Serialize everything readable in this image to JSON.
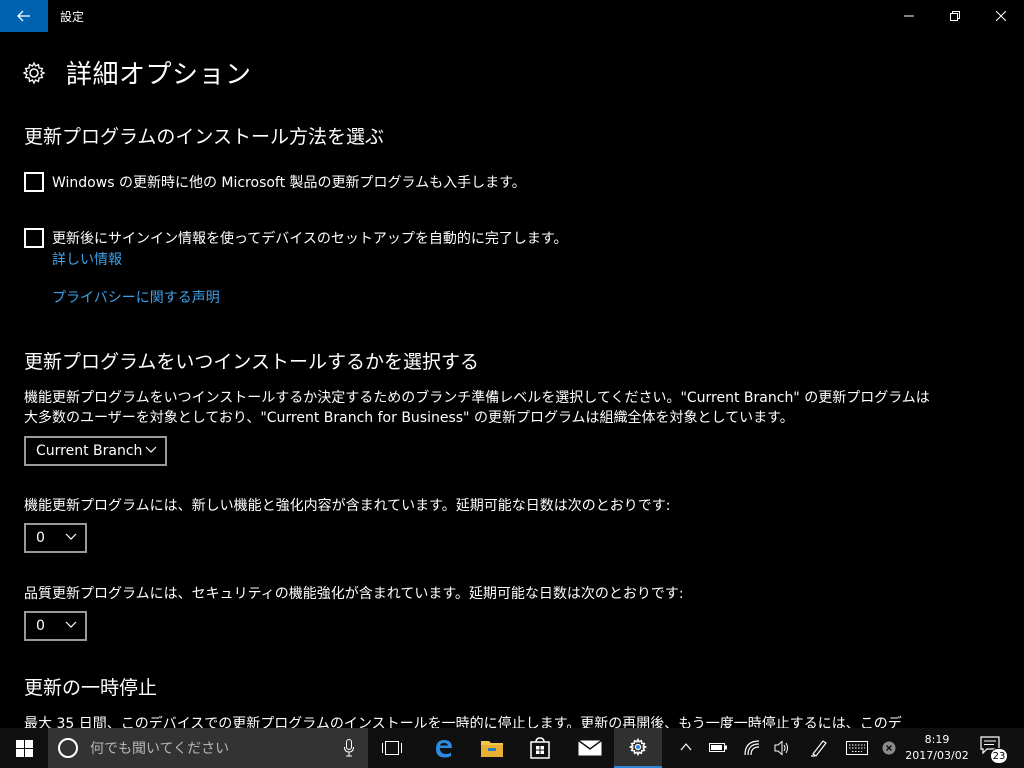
{
  "window": {
    "title": "設定"
  },
  "page": {
    "title": "詳細オプション"
  },
  "section1": {
    "title": "更新プログラムのインストール方法を選ぶ",
    "checkbox1_label": "Windows の更新時に他の Microsoft 製品の更新プログラムも入手します。",
    "checkbox1_checked": false,
    "checkbox2_label": "更新後にサインイン情報を使ってデバイスのセットアップを自動的に完了します。",
    "checkbox2_checked": false,
    "learn_more_link": "詳しい情報",
    "privacy_link": "プライバシーに関する声明"
  },
  "section2": {
    "title": "更新プログラムをいつインストールするかを選択する",
    "description_line1": "機能更新プログラムをいつインストールするか決定するためのブランチ準備レベルを選択してください。\"Current Branch\" の更新プログラムは",
    "description_line2": "大多数のユーザーを対象としており、\"Current Branch for Business\" の更新プログラムは組織全体を対象としています。",
    "branch_dropdown": "Current Branch",
    "feature_text": "機能更新プログラムには、新しい機能と強化内容が含まれています。延期可能な日数は次のとおりです:",
    "feature_days": "0",
    "quality_text": "品質更新プログラムには、セキュリティの機能強化が含まれています。延期可能な日数は次のとおりです:",
    "quality_days": "0"
  },
  "section3": {
    "title": "更新の一時停止",
    "description_partial": "最大 35 日間、このデバイスでの更新プログラムのインストールを一時的に停止します。更新の再開後、もう一度一時停止するには、このデ"
  },
  "taskbar": {
    "search_placeholder": "何でも聞いてください",
    "time": "8:19",
    "date": "2017/03/02",
    "notification_count": "23",
    "apps": [
      "task-view",
      "edge",
      "file-explorer",
      "store",
      "mail",
      "settings"
    ],
    "active_app": "settings"
  },
  "colors": {
    "accent": "#0063b1",
    "link": "#3ea0e6",
    "background": "#000000"
  }
}
